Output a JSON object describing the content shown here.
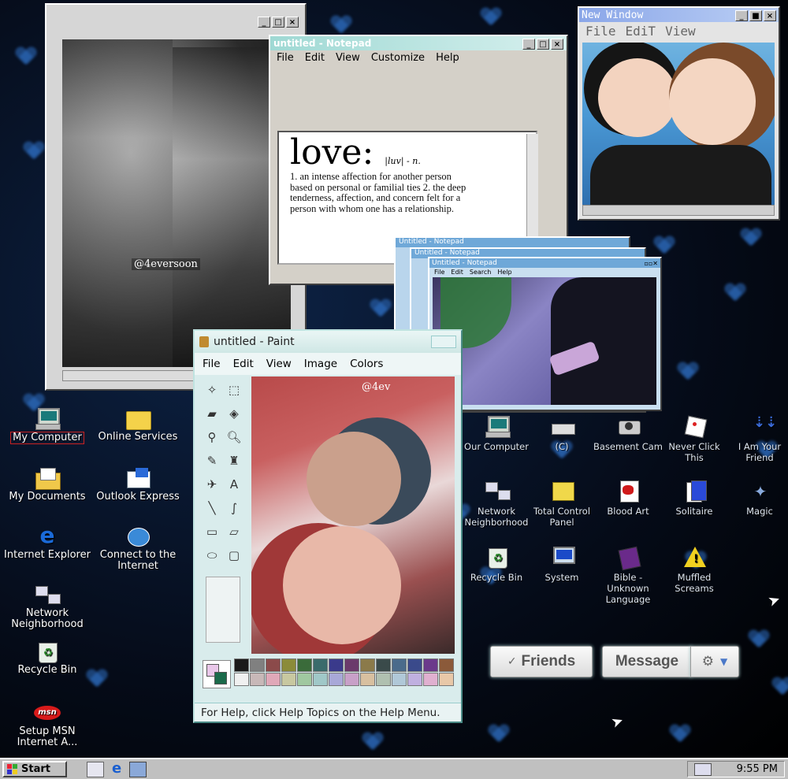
{
  "photo_window": {
    "watermark": "@4eversoon"
  },
  "notepad": {
    "title": "untitled - Notepad",
    "menu": [
      "File",
      "Edit",
      "View",
      "Customize",
      "Help"
    ],
    "word": "love:",
    "pron": "|luv| - n.",
    "definition": "1. an intense affection for another person based on personal or familial ties 2. the deep tenderness, affection, and concern felt for a person with whom one has a relationship."
  },
  "new_window": {
    "title": "New Window",
    "menu": [
      "File",
      "EdiT",
      "View"
    ]
  },
  "mini_notepads": {
    "titles": [
      "Untitled - Notepad",
      "Untitled - Notepad",
      "Untitled - Notepad"
    ],
    "menu": [
      "File",
      "Edit",
      "Search",
      "Help"
    ]
  },
  "paint": {
    "title": "untitled - Paint",
    "menu": [
      "File",
      "Edit",
      "View",
      "Image",
      "Colors"
    ],
    "watermark": "@4ev",
    "status": "For Help, click Help Topics on the Help Menu.",
    "palette": [
      "#1a1a1a",
      "#808080",
      "#8b4a4a",
      "#8b8b3a",
      "#3a6b3a",
      "#3a6b6b",
      "#3a3a8b",
      "#6b3a6b",
      "#8b7a4a",
      "#3a4a4a",
      "#4a6b8b",
      "#3a4a8b",
      "#6b3a8b",
      "#8b5a3a",
      "#f0f0f0",
      "#c8b8b8",
      "#e0a8b8",
      "#c8c8a0",
      "#a0c8a0",
      "#a0c8c8",
      "#a8a8d8",
      "#c8a0c8",
      "#d8c0a0",
      "#b0c0b0",
      "#b0c8d8",
      "#c0b0e0",
      "#e0b0d0",
      "#e8c8a8"
    ]
  },
  "left_icons": [
    {
      "label": "My Computer",
      "icon": "computer-icon"
    },
    {
      "label": "Online Services",
      "icon": "folder-icon"
    },
    {
      "label": "My Documents",
      "icon": "documents-icon"
    },
    {
      "label": "Outlook Express",
      "icon": "outlook-icon"
    },
    {
      "label": "Internet Explorer",
      "icon": "ie-icon"
    },
    {
      "label": "Connect to the Internet",
      "icon": "connect-icon"
    },
    {
      "label": "Network Neighborhood",
      "icon": "network-icon"
    },
    {
      "label": "Recycle Bin",
      "icon": "recycle-bin-icon"
    },
    {
      "label": "Setup MSN Internet A...",
      "icon": "msn-icon"
    }
  ],
  "right_icons": [
    {
      "label": "Our Computer",
      "icon": "computer-icon"
    },
    {
      "label": "(C)",
      "icon": "drive-icon"
    },
    {
      "label": "Basement Cam",
      "icon": "camera-icon"
    },
    {
      "label": "Never Click This",
      "icon": "dice-icon"
    },
    {
      "label": "I Am Your Friend",
      "icon": "shortcut-icon"
    },
    {
      "label": "Network Neighborhood",
      "icon": "network-icon"
    },
    {
      "label": "Total Control Panel",
      "icon": "control-panel-icon"
    },
    {
      "label": "Blood Art",
      "icon": "paint-icon"
    },
    {
      "label": "Solitaire",
      "icon": "solitaire-icon"
    },
    {
      "label": "Magic",
      "icon": "magic-icon"
    },
    {
      "label": "Recycle Bin",
      "icon": "recycle-bin-icon"
    },
    {
      "label": "System",
      "icon": "system-icon"
    },
    {
      "label": "Bible - Unknown Language",
      "icon": "book-icon"
    },
    {
      "label": "Muffled Screams",
      "icon": "warning-icon"
    }
  ],
  "social": {
    "friends": "Friends",
    "message": "Message"
  },
  "taskbar": {
    "start": "Start",
    "clock": "9:55 PM"
  }
}
